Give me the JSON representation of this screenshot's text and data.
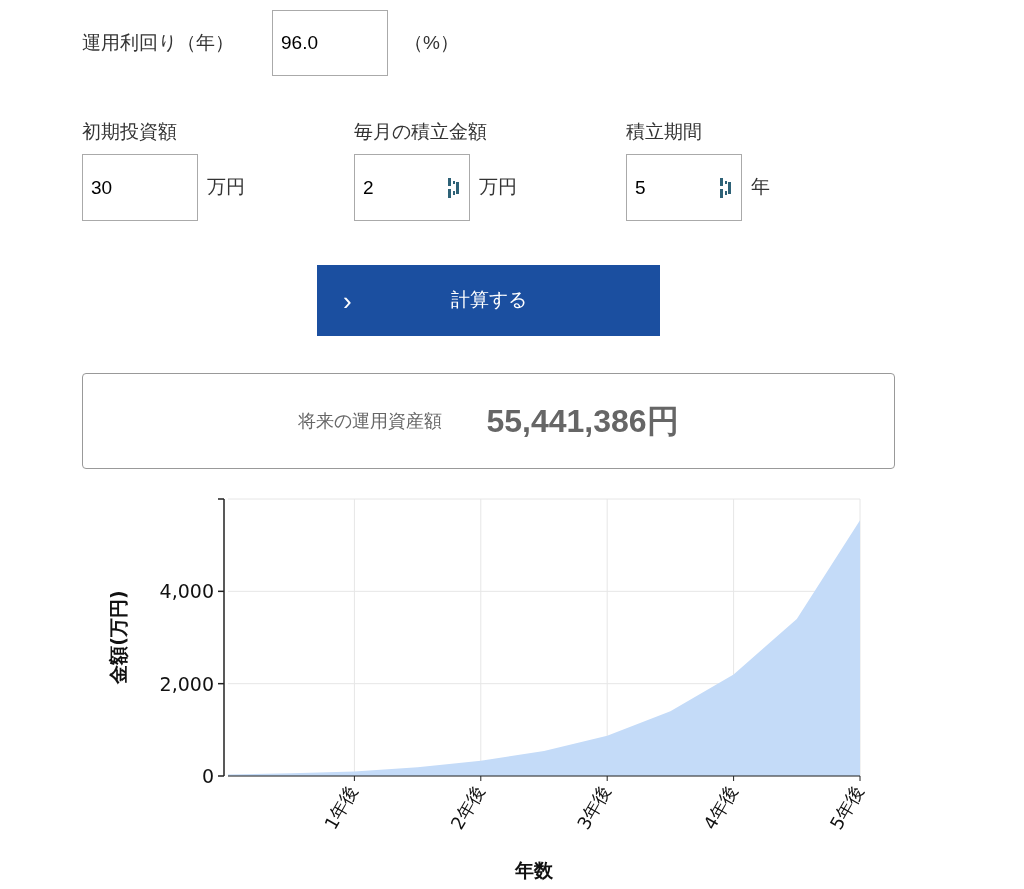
{
  "rate": {
    "label": "運用利回り（年）",
    "value": "96.0",
    "unit": "（%）"
  },
  "inputs": [
    {
      "label": "初期投資額",
      "value": "30",
      "unit": "万円",
      "spinner": false
    },
    {
      "label": "毎月の積立金額",
      "value": "2",
      "unit": "万円",
      "spinner": true
    },
    {
      "label": "積立期間",
      "value": "5",
      "unit": "年",
      "spinner": true
    }
  ],
  "button": {
    "icon": "›",
    "label": "計算する"
  },
  "result": {
    "label": "将来の運用資産額",
    "value": "55,441,386円"
  },
  "chart_data": {
    "type": "area",
    "xlabel": "年数",
    "ylabel": "金額(万円)",
    "x": [
      0,
      0.5,
      1,
      1.5,
      2,
      2.5,
      3,
      3.5,
      4,
      4.5,
      5
    ],
    "series": [
      {
        "color": "#c4dbf8",
        "values": [
          30,
          60,
          100,
          190,
          330,
          540,
          870,
          1400,
          2200,
          3400,
          5540
        ]
      }
    ],
    "grid": true,
    "xlim": [
      0,
      5
    ],
    "ylim": [
      0,
      6000
    ],
    "xticks": [
      {
        "value": 1,
        "label": "1年後"
      },
      {
        "value": 2,
        "label": "2年後"
      },
      {
        "value": 3,
        "label": "3年後"
      },
      {
        "value": 4,
        "label": "4年後"
      },
      {
        "value": 5,
        "label": "5年後"
      }
    ],
    "yticks": [
      {
        "value": 0,
        "label": "0"
      },
      {
        "value": 2000,
        "label": "2,000"
      },
      {
        "value": 4000,
        "label": "4,000"
      }
    ]
  }
}
